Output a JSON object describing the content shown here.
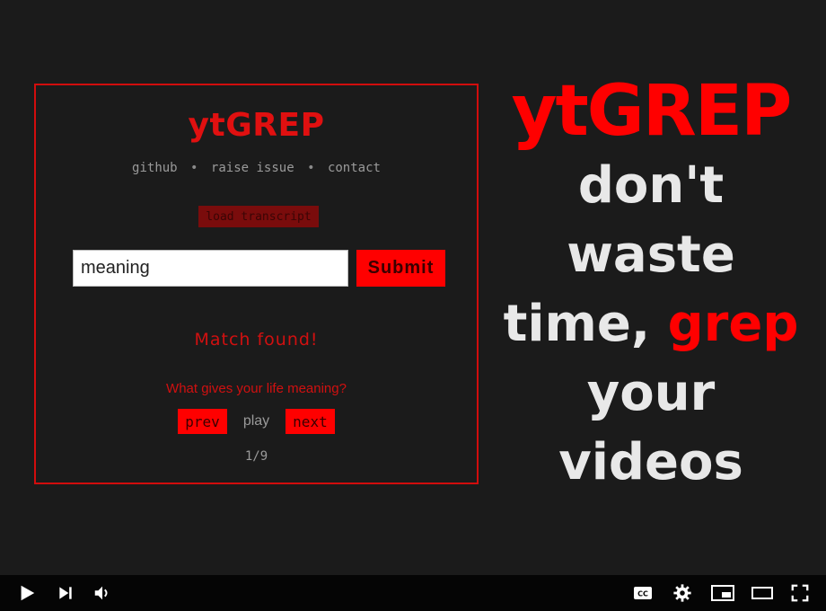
{
  "app": {
    "title": "ytGREP",
    "nav": [
      "github",
      "raise issue",
      "contact"
    ],
    "nav_separator": "•",
    "load_button": "load transcript",
    "search": {
      "value": "meaning",
      "placeholder": ""
    },
    "submit_button": "Submit",
    "status": "Match found!",
    "match_text": "What gives your life meaning?",
    "controls": {
      "prev": "prev",
      "play": "play",
      "next": "next"
    },
    "counter": "1/9"
  },
  "promo": {
    "title": "ytGREP",
    "line1": "don't",
    "line2": "waste",
    "line3_pre": "time, ",
    "line3_accent": "grep",
    "line4": "your",
    "line5": "videos"
  },
  "player": {
    "left_icons": [
      "play-icon",
      "next-icon",
      "volume-icon"
    ],
    "right_icons": [
      "cc-icon",
      "settings-icon",
      "miniplayer-icon",
      "theater-icon",
      "fullscreen-icon"
    ],
    "cc_label": "CC"
  },
  "colors": {
    "background": "#1b1b1b",
    "accent": "#ff0000",
    "panel_border": "#d10d0d",
    "text_light": "#e8e8e8",
    "muted": "#9a9a9a",
    "player_bar": "#050505"
  }
}
